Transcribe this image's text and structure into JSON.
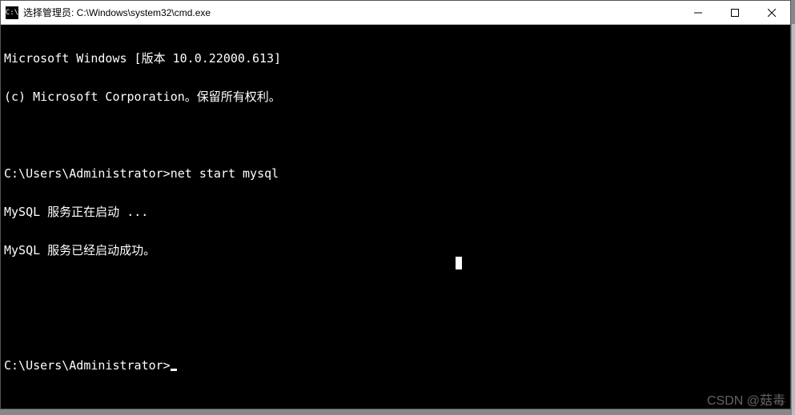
{
  "window": {
    "title": "选择管理员: C:\\Windows\\system32\\cmd.exe",
    "icon_label": "C:\\"
  },
  "terminal": {
    "lines": [
      "Microsoft Windows [版本 10.0.22000.613]",
      "(c) Microsoft Corporation。保留所有权利。",
      "",
      "C:\\Users\\Administrator>net start mysql",
      "MySQL 服务正在启动 ...",
      "MySQL 服务已经启动成功。",
      "",
      "",
      "C:\\Users\\Administrator>"
    ],
    "prompt_cursor": true
  },
  "watermark": "CSDN @菇毒"
}
